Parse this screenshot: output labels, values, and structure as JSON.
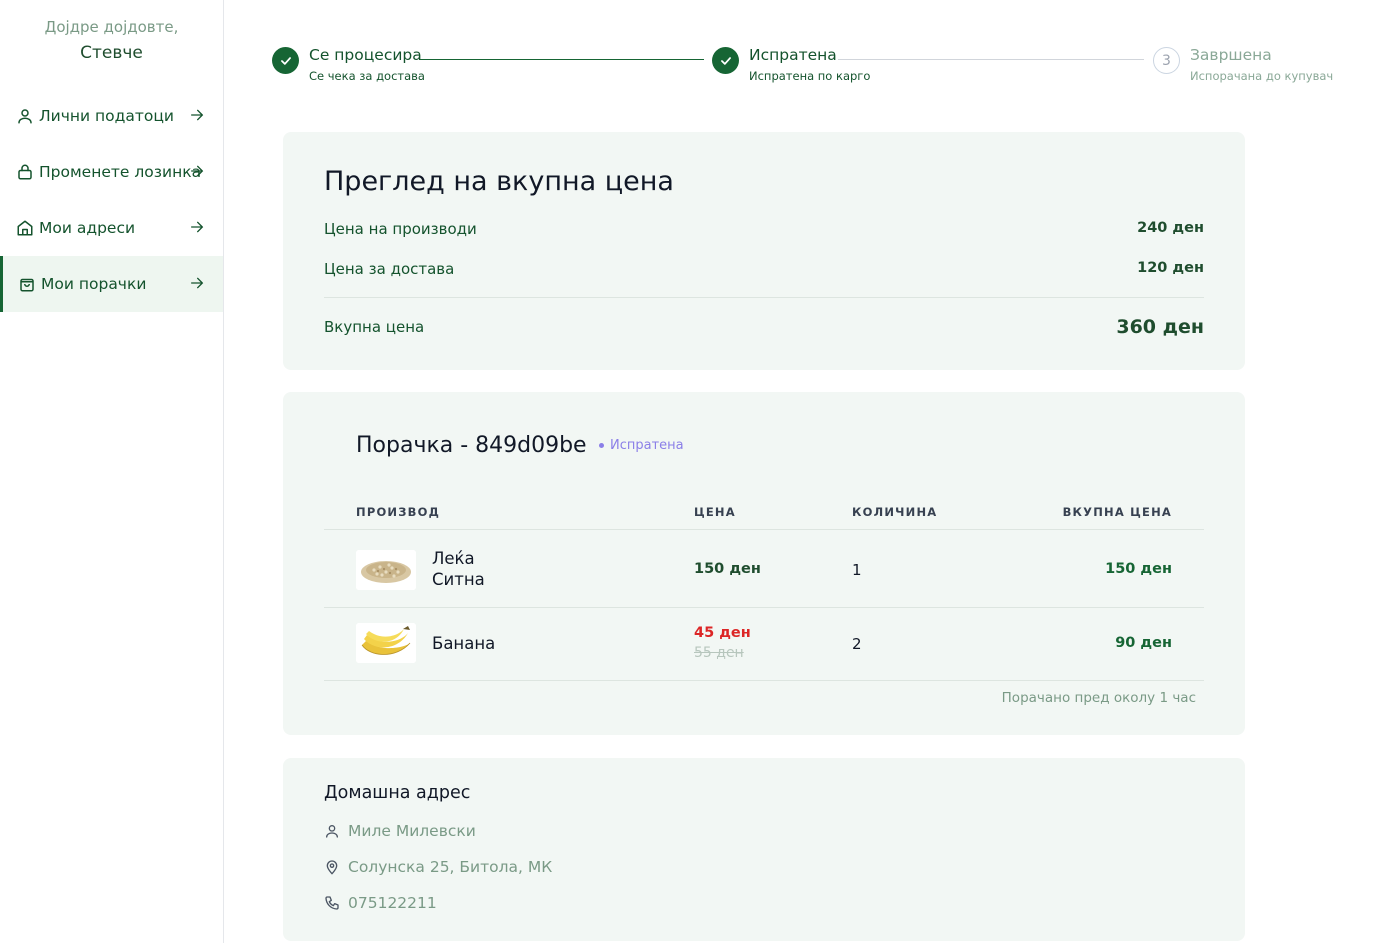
{
  "sidebar": {
    "greeting": "Дојдре дојдовте,",
    "user_name": "Стевче",
    "items": [
      {
        "label": "Лични податоци",
        "icon": "user-icon"
      },
      {
        "label": "Променете лозинка",
        "icon": "lock-icon"
      },
      {
        "label": "Мои адреси",
        "icon": "home-icon"
      },
      {
        "label": "Мои порачки",
        "icon": "shopping-bag-icon",
        "active": true
      }
    ]
  },
  "stepper": {
    "steps": [
      {
        "title": "Се процесира",
        "subtitle": "Се чека за достава",
        "status": "done"
      },
      {
        "title": "Испратена",
        "subtitle": "Испратена по карго",
        "status": "done"
      },
      {
        "number": "3",
        "title": "Завршена",
        "subtitle": "Испорачана до купувач",
        "status": "pending"
      }
    ]
  },
  "summary": {
    "title": "Преглед на вкупна цена",
    "products_label": "Цена на производи",
    "products_value": "240 ден",
    "delivery_label": "Цена за достава",
    "delivery_value": "120 ден",
    "total_label": "Вкупна цена",
    "total_value": "360 ден"
  },
  "order": {
    "title": "Порачка - 849d09be",
    "status": "Испратена",
    "headers": {
      "product": "ПРОИЗВОД",
      "price": "ЦЕНА",
      "quantity": "КОЛИЧИНА",
      "total": "ВКУПНА ЦЕНА"
    },
    "rows": [
      {
        "name_line1": "Леќа",
        "name_line2": "Ситна",
        "price": "150 ден",
        "quantity": "1",
        "total": "150 ден"
      },
      {
        "name": "Банана",
        "price": "45 ден",
        "old_price": "55 ден",
        "quantity": "2",
        "total": "90 ден"
      }
    ],
    "ordered_ago": "Порачано пред околу 1 час"
  },
  "address": {
    "title": "Домашна адрес",
    "name": "Миле Милевски",
    "street": "Солунска 25, Битола, МК",
    "phone": "075122211"
  },
  "colors": {
    "primary": "#166534",
    "card_bg": "#f2f7f4",
    "badge": "#8b7fe8",
    "sale": "#dc2626"
  }
}
